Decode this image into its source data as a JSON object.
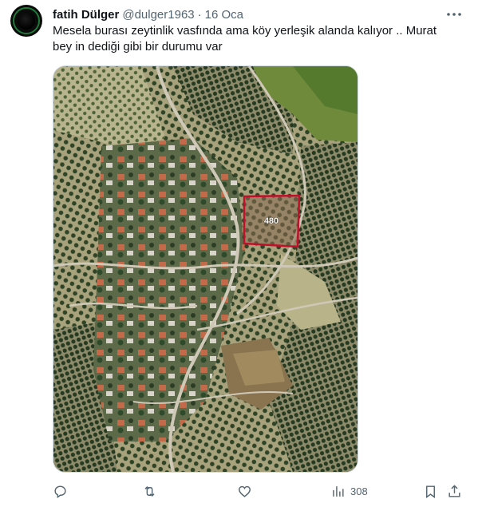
{
  "tweet": {
    "author_name": "fatih Dülger",
    "handle": "@dulger1963",
    "separator": "·",
    "date": "16 Oca",
    "text": "Mesela burası zeytinlik vasfında ama köy yerleşik alanda kalıyor .. Murat bey in dediği gibi bir durumu var",
    "media": {
      "parcel_label": "480",
      "parcel_color": "#c0102a"
    },
    "stats": {
      "views": "308"
    },
    "icons": {
      "more": "more-icon",
      "reply": "reply-icon",
      "retweet": "retweet-icon",
      "like": "like-icon",
      "views": "views-icon",
      "bookmark": "bookmark-icon",
      "share": "share-icon"
    }
  },
  "colors": {
    "text_primary": "#0f1419",
    "text_secondary": "#536471",
    "border": "#cfd9de"
  }
}
